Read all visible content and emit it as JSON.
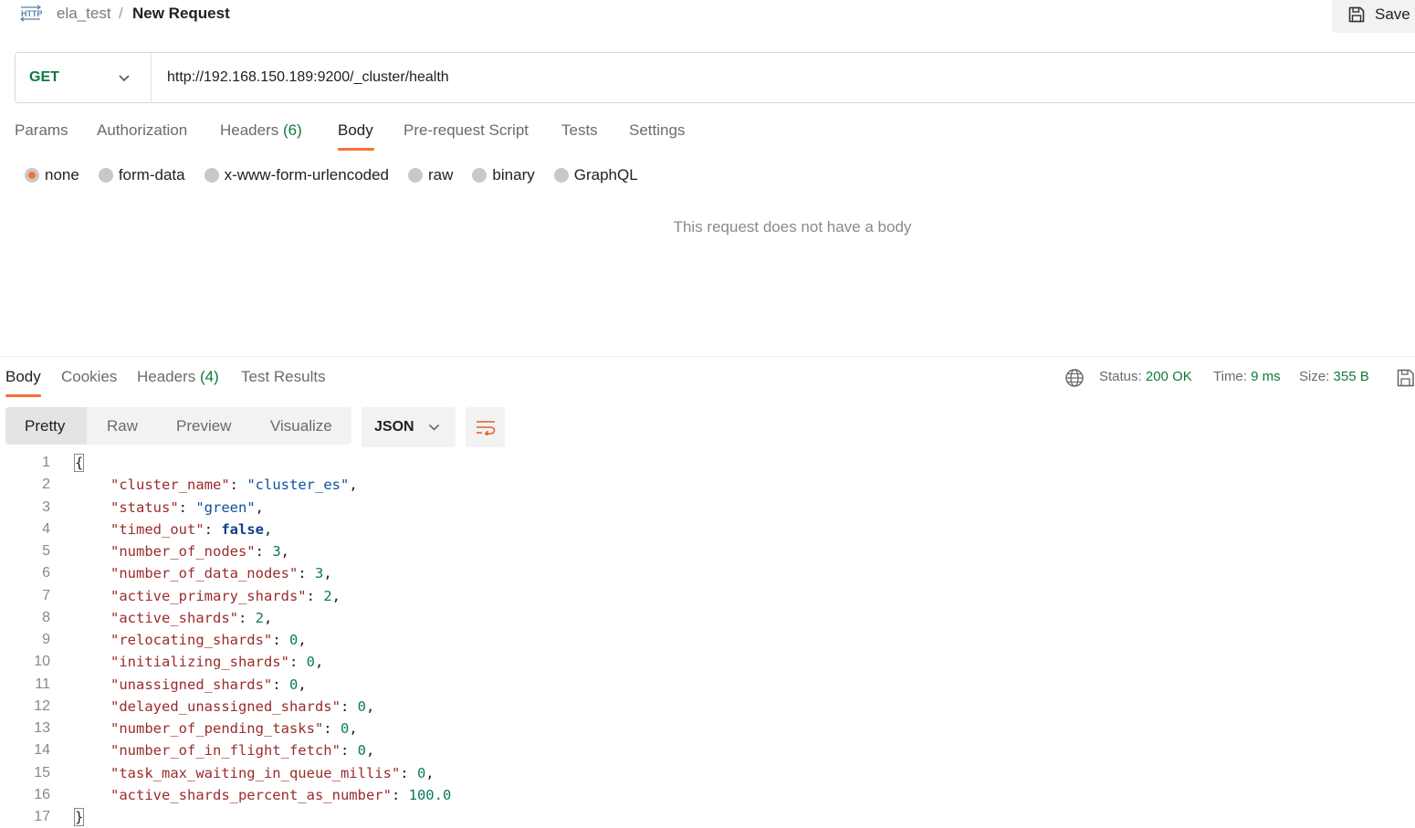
{
  "header": {
    "collection": "ela_test",
    "separator": "/",
    "title": "New Request",
    "save_label": "Save"
  },
  "request": {
    "method": "GET",
    "url": "http://192.168.150.189:9200/_cluster/health"
  },
  "request_tabs": {
    "params": "Params",
    "authorization": "Authorization",
    "headers": "Headers",
    "headers_count": "(6)",
    "body": "Body",
    "prerequest": "Pre-request Script",
    "tests": "Tests",
    "settings": "Settings"
  },
  "body_types": {
    "none": "none",
    "form_data": "form-data",
    "urlencoded": "x-www-form-urlencoded",
    "raw": "raw",
    "binary": "binary",
    "graphql": "GraphQL",
    "selected": "none"
  },
  "no_body_message": "This request does not have a body",
  "response_tabs": {
    "body": "Body",
    "cookies": "Cookies",
    "headers": "Headers",
    "headers_count": "(4)",
    "test_results": "Test Results"
  },
  "response_meta": {
    "status_label": "Status:",
    "status_value": "200 OK",
    "time_label": "Time:",
    "time_value": "9 ms",
    "size_label": "Size:",
    "size_value": "355 B"
  },
  "view_modes": {
    "pretty": "Pretty",
    "raw": "Raw",
    "preview": "Preview",
    "visualize": "Visualize"
  },
  "format": "JSON",
  "response_lines": [
    {
      "n": "1",
      "kind": "open",
      "text": "{"
    },
    {
      "n": "2",
      "kind": "str",
      "key": "\"cluster_name\"",
      "val": "\"cluster_es\"",
      "comma": ","
    },
    {
      "n": "3",
      "kind": "str",
      "key": "\"status\"",
      "val": "\"green\"",
      "comma": ","
    },
    {
      "n": "4",
      "kind": "bool",
      "key": "\"timed_out\"",
      "val": "false",
      "comma": ","
    },
    {
      "n": "5",
      "kind": "num",
      "key": "\"number_of_nodes\"",
      "val": "3",
      "comma": ","
    },
    {
      "n": "6",
      "kind": "num",
      "key": "\"number_of_data_nodes\"",
      "val": "3",
      "comma": ","
    },
    {
      "n": "7",
      "kind": "num",
      "key": "\"active_primary_shards\"",
      "val": "2",
      "comma": ","
    },
    {
      "n": "8",
      "kind": "num",
      "key": "\"active_shards\"",
      "val": "2",
      "comma": ","
    },
    {
      "n": "9",
      "kind": "num",
      "key": "\"relocating_shards\"",
      "val": "0",
      "comma": ","
    },
    {
      "n": "10",
      "kind": "num",
      "key": "\"initializing_shards\"",
      "val": "0",
      "comma": ","
    },
    {
      "n": "11",
      "kind": "num",
      "key": "\"unassigned_shards\"",
      "val": "0",
      "comma": ","
    },
    {
      "n": "12",
      "kind": "num",
      "key": "\"delayed_unassigned_shards\"",
      "val": "0",
      "comma": ","
    },
    {
      "n": "13",
      "kind": "num",
      "key": "\"number_of_pending_tasks\"",
      "val": "0",
      "comma": ","
    },
    {
      "n": "14",
      "kind": "num",
      "key": "\"number_of_in_flight_fetch\"",
      "val": "0",
      "comma": ","
    },
    {
      "n": "15",
      "kind": "num",
      "key": "\"task_max_waiting_in_queue_millis\"",
      "val": "0",
      "comma": ","
    },
    {
      "n": "16",
      "kind": "num",
      "key": "\"active_shards_percent_as_number\"",
      "val": "100.0",
      "comma": ""
    },
    {
      "n": "17",
      "kind": "close",
      "text": "}"
    }
  ],
  "icons": {
    "http": "http-icon",
    "save": "floppy-disk-icon",
    "method_dropdown": "chevron-down-icon",
    "globe": "globe-icon",
    "save_response": "save-response-icon",
    "format_dropdown": "chevron-down-icon",
    "wrap": "wrap-lines-icon"
  },
  "colors": {
    "accent": "#ff6c37",
    "method_get": "#0f7a3c",
    "status_ok": "#0f7a3c",
    "json_key": "#9b2b2b",
    "json_string": "#0c4f9e",
    "json_number": "#097a60"
  }
}
